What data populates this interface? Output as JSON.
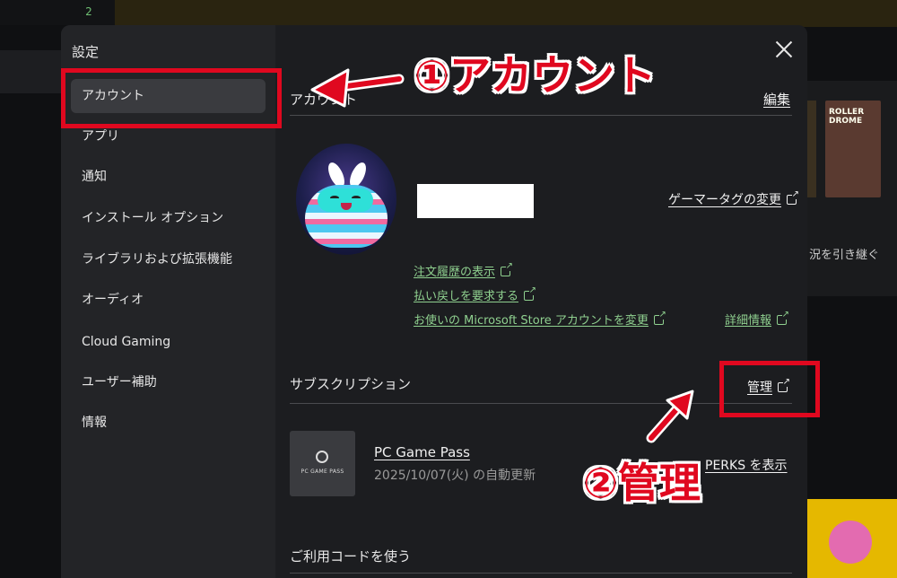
{
  "background": {
    "badge_count": "2",
    "thumb_text": "ROLLER DROME",
    "right_text": "況を引き継ぐ"
  },
  "sidebar": {
    "title": "設定",
    "items": [
      {
        "label": "アカウント",
        "active": true
      },
      {
        "label": "アプリ"
      },
      {
        "label": "通知"
      },
      {
        "label": "インストール オプション"
      },
      {
        "label": "ライブラリおよび拡張機能"
      },
      {
        "label": "オーディオ"
      },
      {
        "label": "Cloud Gaming"
      },
      {
        "label": "ユーザー補助"
      },
      {
        "label": "情報"
      }
    ]
  },
  "account": {
    "section_title": "アカウント",
    "edit_label": "編集",
    "gamertag_link": "ゲーマータグの変更",
    "links": [
      "注文履歴の表示",
      "払い戻しを要求する",
      "お使いの Microsoft Store アカウントを変更"
    ],
    "details_link": "詳細情報"
  },
  "subscription": {
    "section_title": "サブスクリプション",
    "manage_label": "管理",
    "tile_label": "PC GAME PASS",
    "name": "PC Game Pass",
    "renewal": "2025/10/07(火) の自動更新",
    "perks_label": "PERKS を表示"
  },
  "redeem": {
    "section_title": "ご利用コードを使う"
  },
  "annotations": {
    "label1": "①アカウント",
    "label2": "②管理",
    "color": "#e0081f"
  }
}
